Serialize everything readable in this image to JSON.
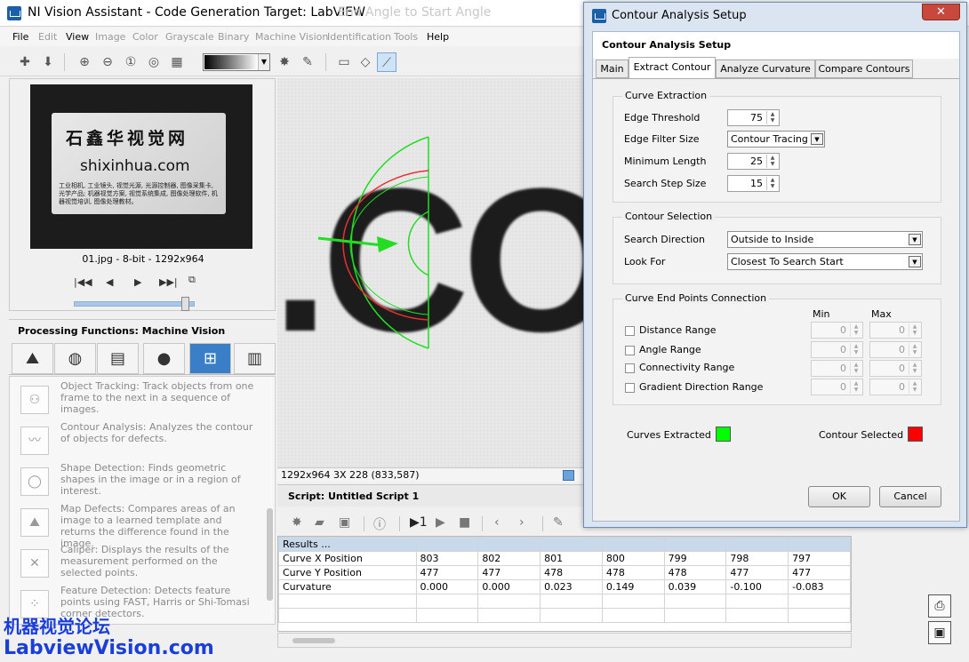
{
  "window": {
    "title": "NI Vision Assistant - Code Generation Target: LabVIEW",
    "ghost_title": "End Angle to Start Angle"
  },
  "menu": [
    "File",
    "Edit",
    "View",
    "Image",
    "Color",
    "Grayscale",
    "Binary",
    "Machine Vision",
    "Identification",
    "Tools",
    "Help"
  ],
  "thumbnail": {
    "card_cn": "石鑫华视觉网",
    "card_domain": "shixinhua.com",
    "card_text": "工业相机, 工业镜头, 视觉光源, 光源控制器, 图像采集卡, 光学产品; 机器视觉方案, 视觉系统集成, 图像处理软件, 机器视觉培训, 图像处理教材。",
    "caption": "01.jpg - 8-bit - 1292x964",
    "slider_level": 0.92
  },
  "processing": {
    "header": "Processing Functions: Machine Vision",
    "items": [
      {
        "icon": "object-tracking-icon",
        "glyph": "⚇",
        "text": "Object Tracking:  Track objects from one frame to the next in a sequence of images."
      },
      {
        "icon": "contour-analysis-icon",
        "glyph": "〰",
        "text": "Contour Analysis:  Analyzes the contour of objects for defects."
      },
      {
        "icon": "shape-detection-icon",
        "glyph": "◯",
        "text": "Shape Detection:  Finds geometric shapes in the image or in a region of interest."
      },
      {
        "icon": "map-defects-icon",
        "glyph": "⛰",
        "text": "Map Defects:  Compares areas of an image to a learned template and returns the difference found in the image."
      },
      {
        "icon": "caliper-icon",
        "glyph": "✕",
        "text": "Caliper:  Displays the results of the measurement performed on the selected points."
      },
      {
        "icon": "feature-detection-icon",
        "glyph": "⁘",
        "text": "Feature Detection:  Detects feature points using FAST, Harris or Shi-Tomasi corner detectors."
      }
    ]
  },
  "viewer": {
    "overlay_text": ".CO",
    "status": "1292x964 3X 228    (833,587)"
  },
  "script": {
    "title": "Script: Untitled Script 1",
    "results_header": "Results ...",
    "rows": [
      {
        "label": "Curve X Position",
        "values": [
          "803",
          "802",
          "801",
          "800",
          "799",
          "798",
          "797"
        ]
      },
      {
        "label": "Curve Y Position",
        "values": [
          "477",
          "477",
          "478",
          "478",
          "478",
          "477",
          "477"
        ]
      },
      {
        "label": "Curvature",
        "values": [
          "0.000",
          "0.000",
          "0.023",
          "0.149",
          "0.039",
          "-0.100",
          "-0.083"
        ]
      }
    ]
  },
  "watermark": {
    "line1": "机器视觉论坛",
    "line2": "LabviewVision.com"
  },
  "dialog": {
    "title": "Contour Analysis Setup",
    "subtitle": "Contour Analysis Setup",
    "tabs": [
      "Main",
      "Extract Contour",
      "Analyze Curvature",
      "Compare Contours"
    ],
    "active_tab": "Extract Contour",
    "curve_extraction": {
      "title": "Curve Extraction",
      "edge_threshold_label": "Edge Threshold",
      "edge_threshold": "75",
      "edge_filter_label": "Edge Filter Size",
      "edge_filter": "Contour Tracing",
      "min_length_label": "Minimum Length",
      "min_length": "25",
      "search_step_label": "Search Step Size",
      "search_step": "15"
    },
    "contour_selection": {
      "title": "Contour Selection",
      "direction_label": "Search Direction",
      "direction": "Outside to Inside",
      "look_for_label": "Look For",
      "look_for": "Closest To Search Start"
    },
    "end_points": {
      "title": "Curve End Points Connection",
      "min_label": "Min",
      "max_label": "Max",
      "rows": [
        {
          "label": "Distance Range",
          "min": "0",
          "max": "0"
        },
        {
          "label": "Angle Range",
          "min": "0",
          "max": "0"
        },
        {
          "label": "Connectivity Range",
          "min": "0",
          "max": "0"
        },
        {
          "label": "Gradient Direction Range",
          "min": "0",
          "max": "0"
        }
      ]
    },
    "legend": {
      "curves_label": "Curves Extracted",
      "curves_color": "#00ff00",
      "selected_label": "Contour Selected",
      "selected_color": "#ff0000"
    },
    "ok_label": "OK",
    "cancel_label": "Cancel"
  }
}
